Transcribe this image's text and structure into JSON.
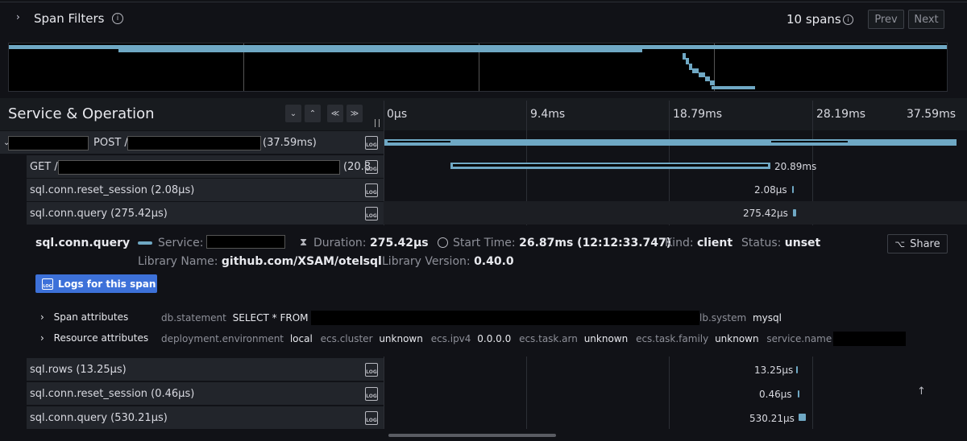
{
  "header": {
    "title": "Span Filters",
    "spans_count": "10 spans",
    "prev_label": "Prev",
    "next_label": "Next"
  },
  "column": {
    "title": "Service & Operation"
  },
  "timeline": {
    "ticks": [
      "0µs",
      "9.4ms",
      "18.79ms",
      "28.19ms",
      "37.59ms"
    ]
  },
  "rows": [
    {
      "label_pre": "POST /",
      "label_post": "(37.59ms)",
      "duration": ""
    },
    {
      "label_pre": "GET /",
      "label_post": "(20.8",
      "duration": "20.89ms"
    },
    {
      "label": "sql.conn.reset_session (2.08µs)",
      "duration": "2.08µs"
    },
    {
      "label": "sql.conn.query (275.42µs)",
      "duration": "275.42µs"
    },
    {
      "label": "sql.rows (13.25µs)",
      "duration": "13.25µs"
    },
    {
      "label": "sql.conn.reset_session (0.46µs)",
      "duration": "0.46µs"
    },
    {
      "label": "sql.conn.query (530.21µs)",
      "duration": "530.21µs"
    }
  ],
  "detail": {
    "title": "sql.conn.query",
    "service_label": "Service:",
    "duration_label": "Duration:",
    "duration_value": "275.42µs",
    "start_label": "Start Time:",
    "start_value": "26.87ms (12:12:33.747)",
    "kind_label": "Kind:",
    "kind_value": "client",
    "status_label": "Status:",
    "status_value": "unset",
    "share_label": "Share",
    "library_name_label": "Library Name:",
    "library_name_value": "github.com/XSAM/otelsql",
    "library_version_label": "Library Version:",
    "library_version_value": "0.40.0",
    "logs_button": "Logs for this span",
    "span_attributes_label": "Span attributes",
    "span_attr": {
      "k1": "db.statement",
      "v1": "SELECT * FROM",
      "k2": "lb.system",
      "v2": "mysql"
    },
    "resource_attributes_label": "Resource attributes",
    "res_attr": {
      "k1": "deployment.environment",
      "v1": "local",
      "k2": "ecs.cluster",
      "v2": "unknown",
      "k3": "ecs.ipv4",
      "v3": "0.0.0.0",
      "k4": "ecs.task.arn",
      "v4": "unknown",
      "k5": "ecs.task.family",
      "v5": "unknown",
      "k6": "service.name"
    }
  },
  "icons": {
    "log": "LOG",
    "info": "info-icon",
    "chevron": "chevron-right-icon"
  },
  "colors": {
    "bar": "#6fa8c4",
    "button_blue": "#3d71d9"
  }
}
